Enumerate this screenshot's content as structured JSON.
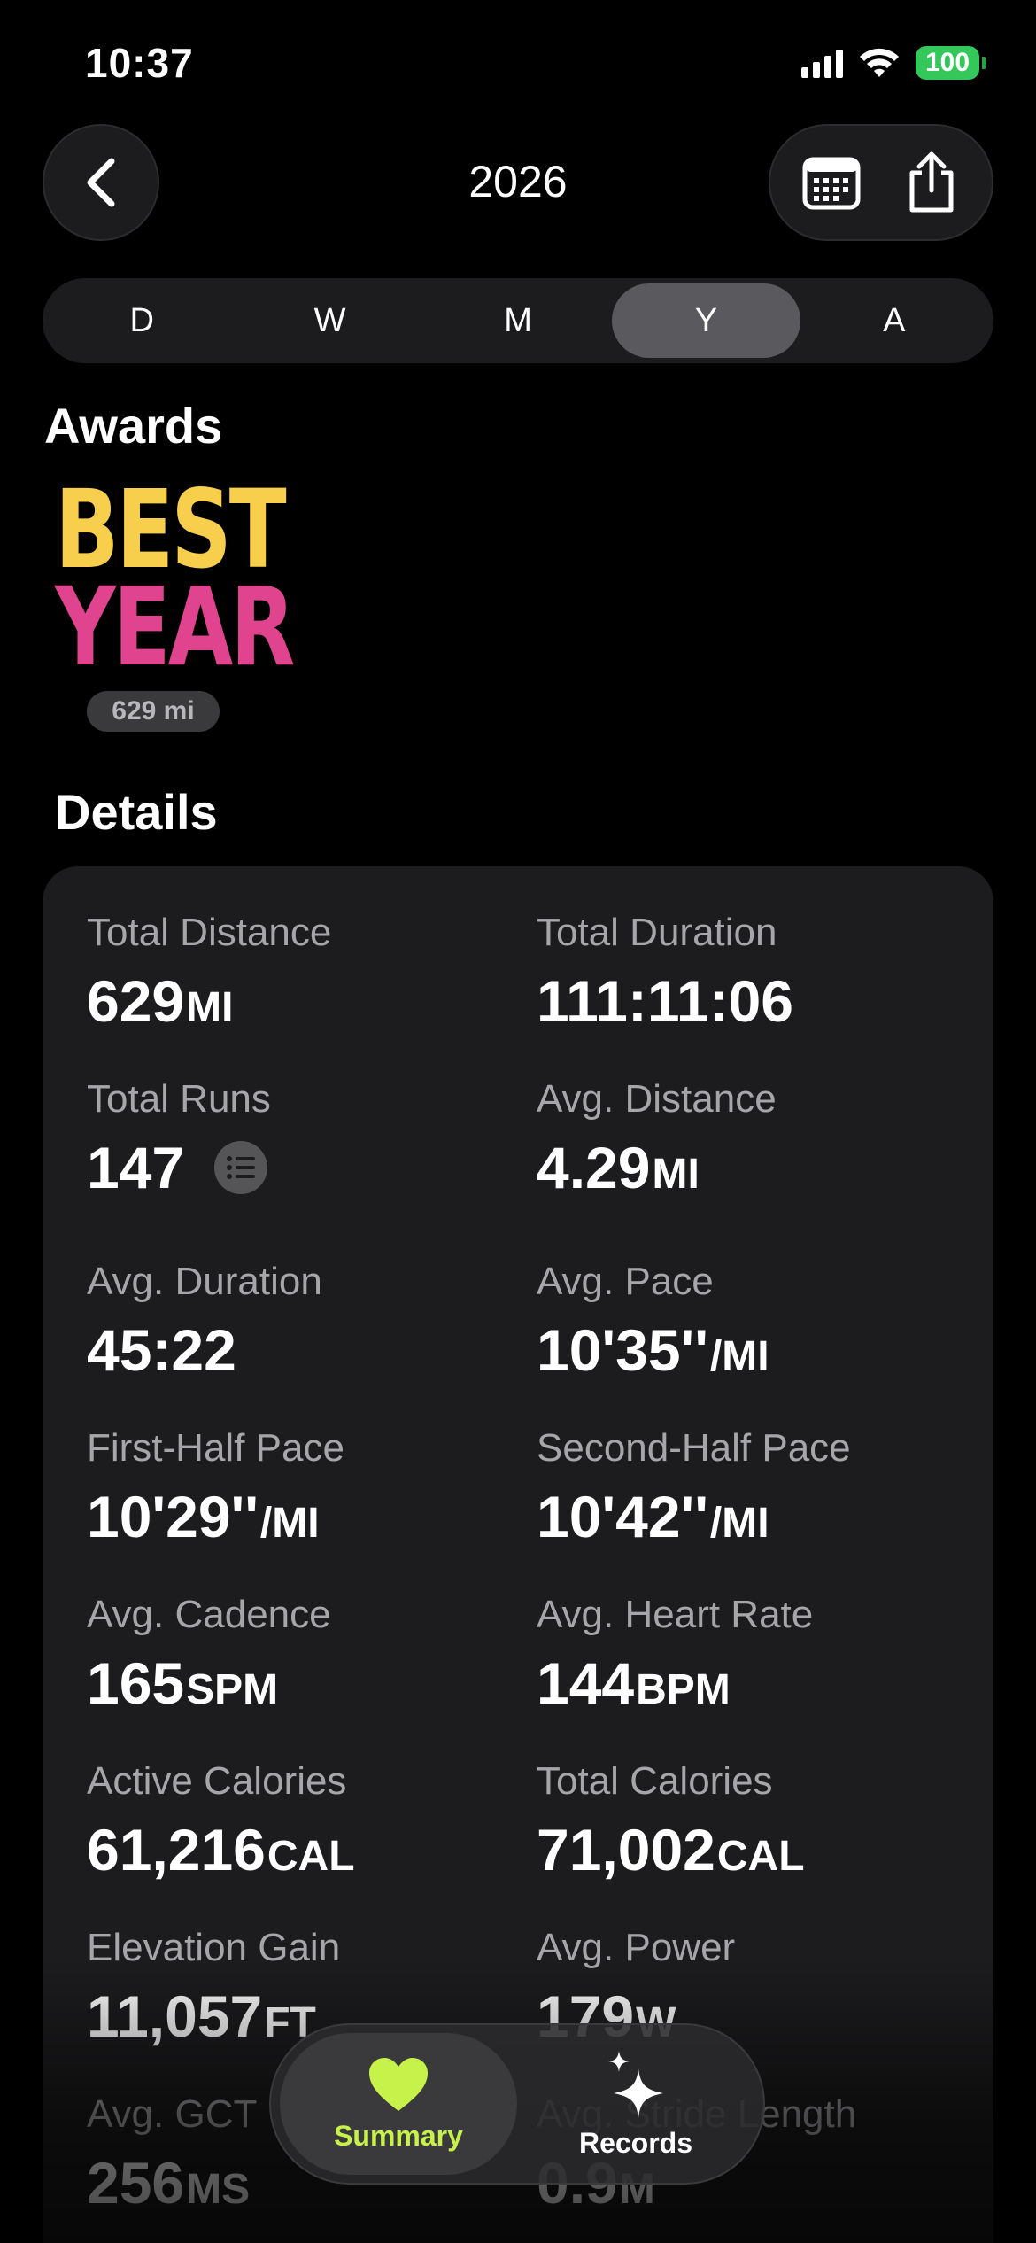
{
  "status_bar": {
    "time": "10:37",
    "battery": "100"
  },
  "header": {
    "title": "2026"
  },
  "segments": [
    "D",
    "W",
    "M",
    "Y",
    "A"
  ],
  "active_segment": "Y",
  "awards": {
    "title": "Awards",
    "items": [
      {
        "line1": "BEST",
        "line2": "YEAR",
        "badge": "629 mi"
      }
    ]
  },
  "details": {
    "title": "Details",
    "metrics": [
      {
        "label": "Total Distance",
        "value": "629",
        "unit": "MI"
      },
      {
        "label": "Total Duration",
        "value": "111:11:06",
        "unit": ""
      },
      {
        "label": "Total Runs",
        "value": "147",
        "unit": ""
      },
      {
        "label": "Avg. Distance",
        "value": "4.29",
        "unit": "MI"
      },
      {
        "label": "Avg. Duration",
        "value": "45:22",
        "unit": ""
      },
      {
        "label": "Avg. Pace",
        "value": "10'35''",
        "unit": "/MI"
      },
      {
        "label": "First-Half Pace",
        "value": "10'29''",
        "unit": "/MI"
      },
      {
        "label": "Second-Half Pace",
        "value": "10'42''",
        "unit": "/MI"
      },
      {
        "label": "Avg. Cadence",
        "value": "165",
        "unit": "SPM"
      },
      {
        "label": "Avg. Heart Rate",
        "value": "144",
        "unit": "BPM"
      },
      {
        "label": "Active Calories",
        "value": "61,216",
        "unit": "CAL"
      },
      {
        "label": "Total Calories",
        "value": "71,002",
        "unit": "CAL"
      },
      {
        "label": "Elevation Gain",
        "value": "11,057",
        "unit": "FT"
      },
      {
        "label": "Avg. Power",
        "value": "179",
        "unit": "W"
      },
      {
        "label": "Avg. GCT",
        "value": "256",
        "unit": "MS"
      },
      {
        "label": "Avg. Stride Length",
        "value": "0.9",
        "unit": "M"
      }
    ]
  },
  "tabbar": {
    "items": [
      {
        "label": "Summary",
        "icon": "heart-icon",
        "active": true
      },
      {
        "label": "Records",
        "icon": "sparkles-icon",
        "active": false
      }
    ]
  },
  "colors": {
    "accent": "#c6f24a",
    "battery": "#34c759",
    "award_yellow": "#f7cf4d",
    "award_pink": "#e0448f"
  }
}
